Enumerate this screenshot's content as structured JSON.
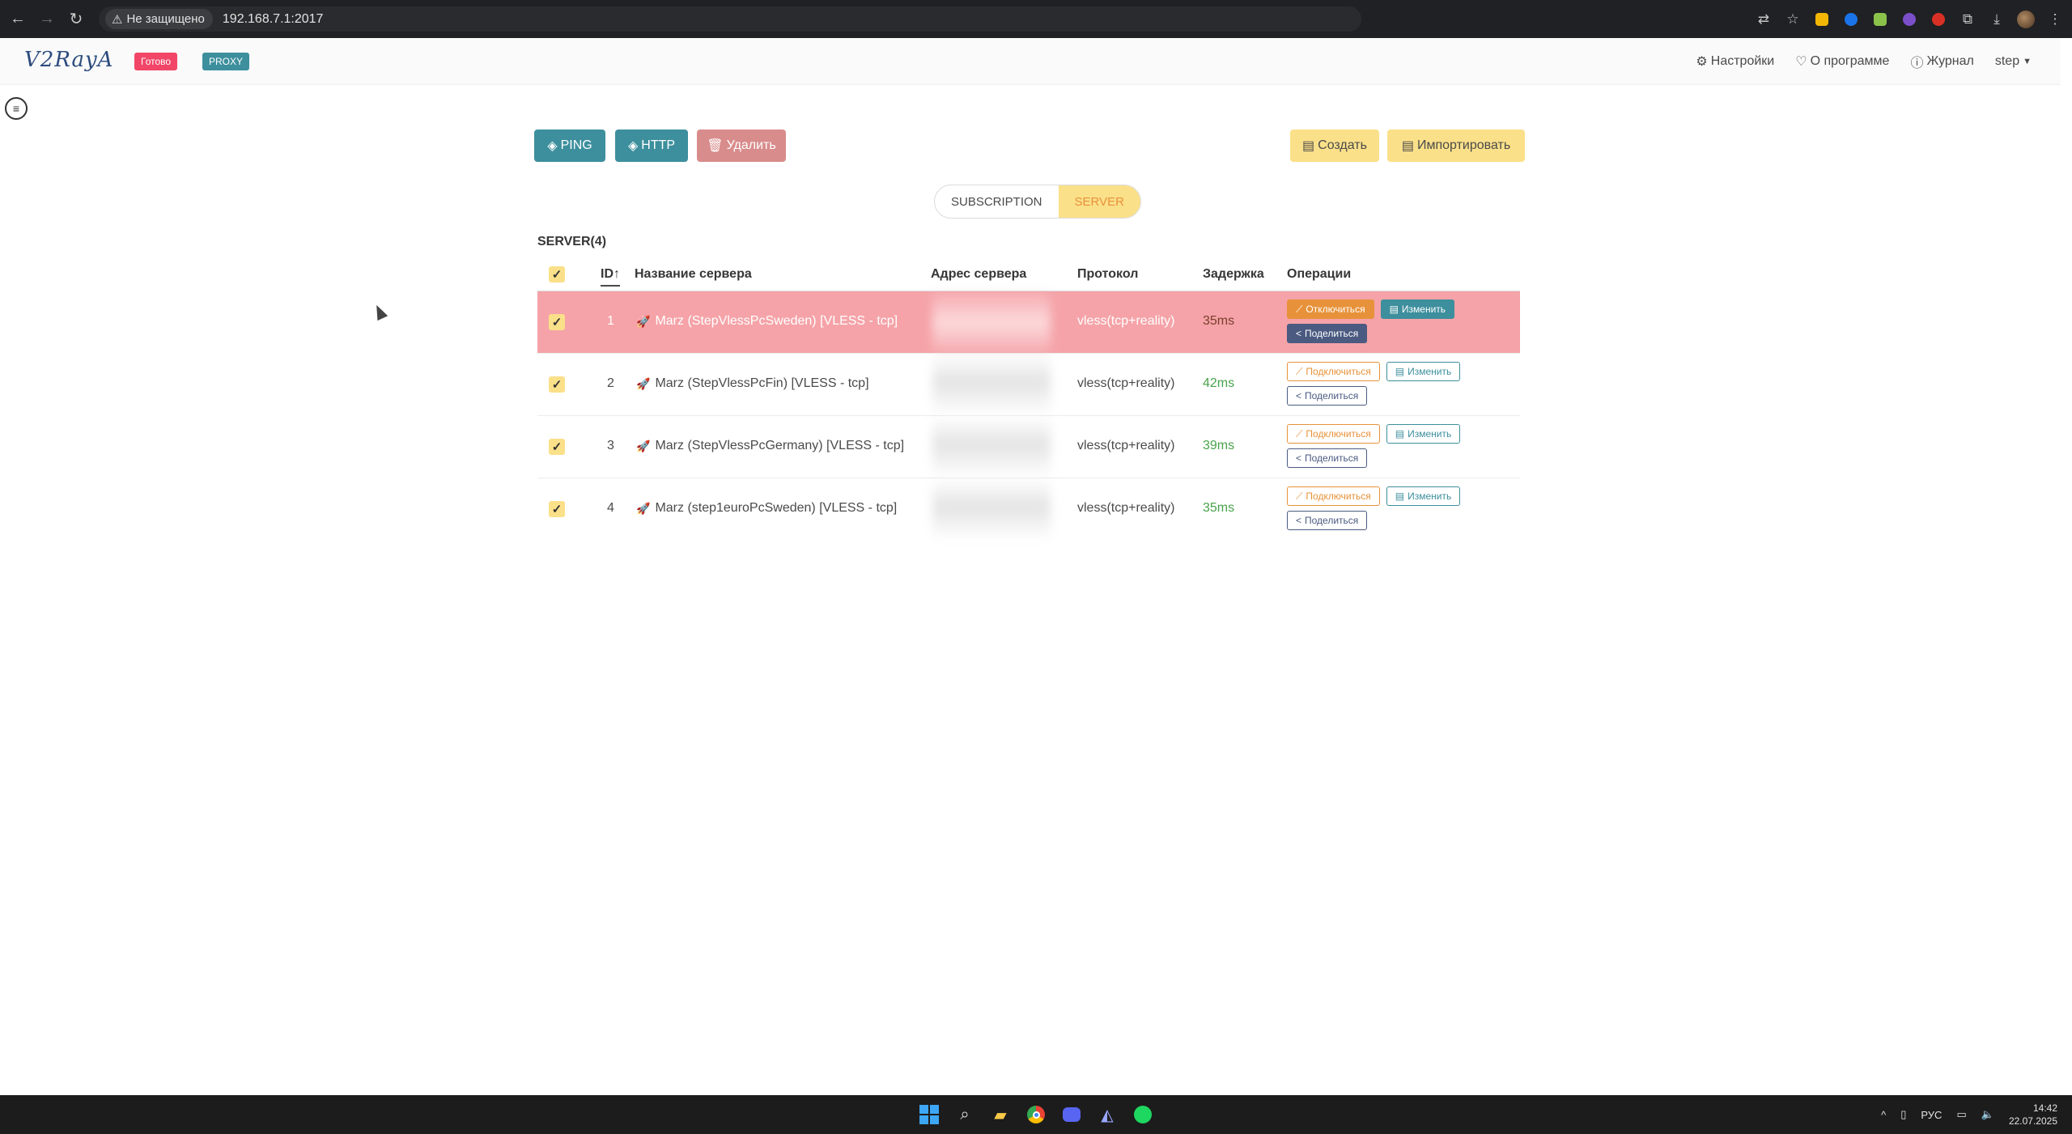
{
  "browser": {
    "security_label": "Не защищено",
    "url": "192.168.7.1:2017"
  },
  "app": {
    "logo": "V2RayA",
    "status_tag": "Готово",
    "mode_tag": "PROXY",
    "nav": {
      "settings": "Настройки",
      "about": "О программе",
      "log": "Журнал",
      "user": "step"
    }
  },
  "toolbar": {
    "ping": "PING",
    "http": "HTTP",
    "delete": "Удалить",
    "create": "Создать",
    "import": "Импортировать"
  },
  "tabs": {
    "subscription": "SUBSCRIPTION",
    "server": "SERVER",
    "active": "SERVER"
  },
  "table": {
    "caption": "SERVER(4)",
    "headers": {
      "id": "ID",
      "name": "Название сервера",
      "address": "Адрес сервера",
      "protocol": "Протокол",
      "latency": "Задержка",
      "operations": "Операции"
    },
    "rows": [
      {
        "id": "1",
        "name": "Marz (StepVlessPcSweden) [VLESS - tcp]",
        "protocol": "vless(tcp+reality)",
        "latency": "35ms",
        "selected": true
      },
      {
        "id": "2",
        "name": "Marz (StepVlessPcFin) [VLESS - tcp]",
        "protocol": "vless(tcp+reality)",
        "latency": "42ms",
        "selected": false
      },
      {
        "id": "3",
        "name": "Marz (StepVlessPcGermany) [VLESS - tcp]",
        "protocol": "vless(tcp+reality)",
        "latency": "39ms",
        "selected": false
      },
      {
        "id": "4",
        "name": "Marz (step1euroPcSweden) [VLESS - tcp]",
        "protocol": "vless(tcp+reality)",
        "latency": "35ms",
        "selected": false
      }
    ],
    "ops": {
      "connect": "Подключиться",
      "disconnect": "Отключиться",
      "edit": "Изменить",
      "share": "Поделиться"
    }
  },
  "taskbar": {
    "lang": "РУС",
    "time": "14:42",
    "date": "22.07.2025"
  },
  "colors": {
    "accent_teal": "#3d8f9d",
    "accent_yellow": "#fbe08a",
    "selected_row": "#f5a3a8",
    "danger": "#f14668"
  }
}
